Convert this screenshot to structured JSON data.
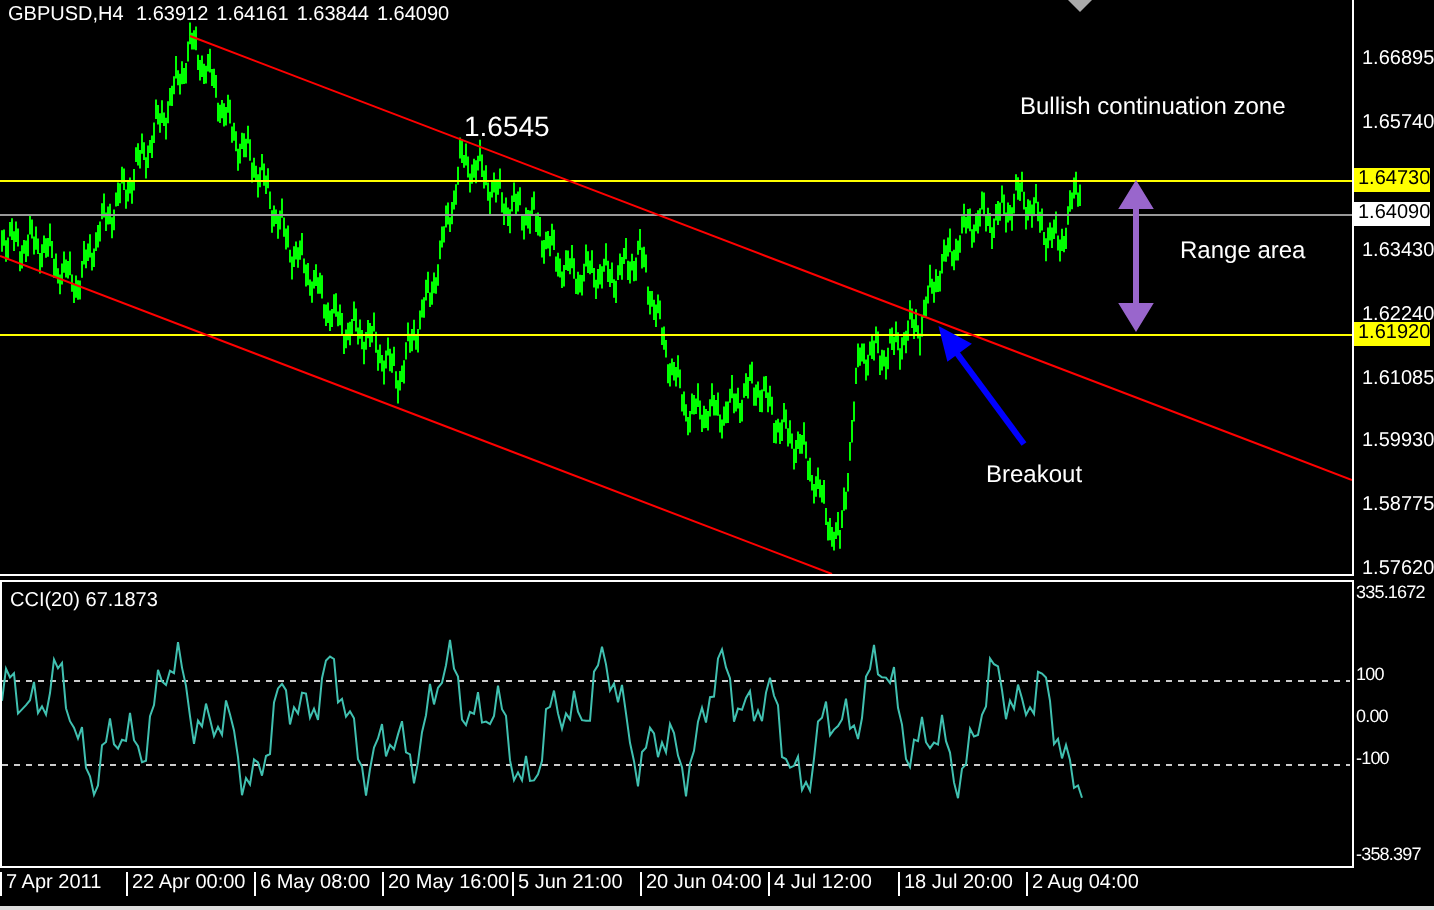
{
  "header": {
    "symbol": "GBPUSD,H4",
    "quotes": [
      "1.63912",
      "1.64161",
      "1.63844",
      "1.64090"
    ]
  },
  "annotations": [
    {
      "text": "1.6545"
    },
    {
      "text": "Bullish continuation zone"
    },
    {
      "text": "Range area"
    },
    {
      "text": "Breakout"
    }
  ],
  "price_axis": [
    {
      "text": "1.66895",
      "kind": "tick"
    },
    {
      "text": "1.65740",
      "kind": "tick"
    },
    {
      "text": "1.64730",
      "kind": "highlight"
    },
    {
      "text": "1.64090",
      "kind": "current"
    },
    {
      "text": "1.63430",
      "kind": "tick"
    },
    {
      "text": "1.62240",
      "kind": "tick"
    },
    {
      "text": "1.61920",
      "kind": "highlight"
    },
    {
      "text": "1.61085",
      "kind": "tick"
    },
    {
      "text": "1.59930",
      "kind": "tick"
    },
    {
      "text": "1.58775",
      "kind": "tick"
    },
    {
      "text": "1.57620",
      "kind": "tick"
    }
  ],
  "cci": {
    "title": "CCI(20) 67.1873",
    "axis": [
      "335.1672",
      "100",
      "0.00",
      "-100",
      "-358.397"
    ]
  },
  "time_axis": [
    "7 Apr 2011",
    "22 Apr 00:00",
    "6 May 08:00",
    "20 May 16:00",
    "5 Jun 21:00",
    "20 Jun 04:00",
    "4 Jul 12:00",
    "18 Jul 20:00",
    "2 Aug 04:00"
  ]
}
